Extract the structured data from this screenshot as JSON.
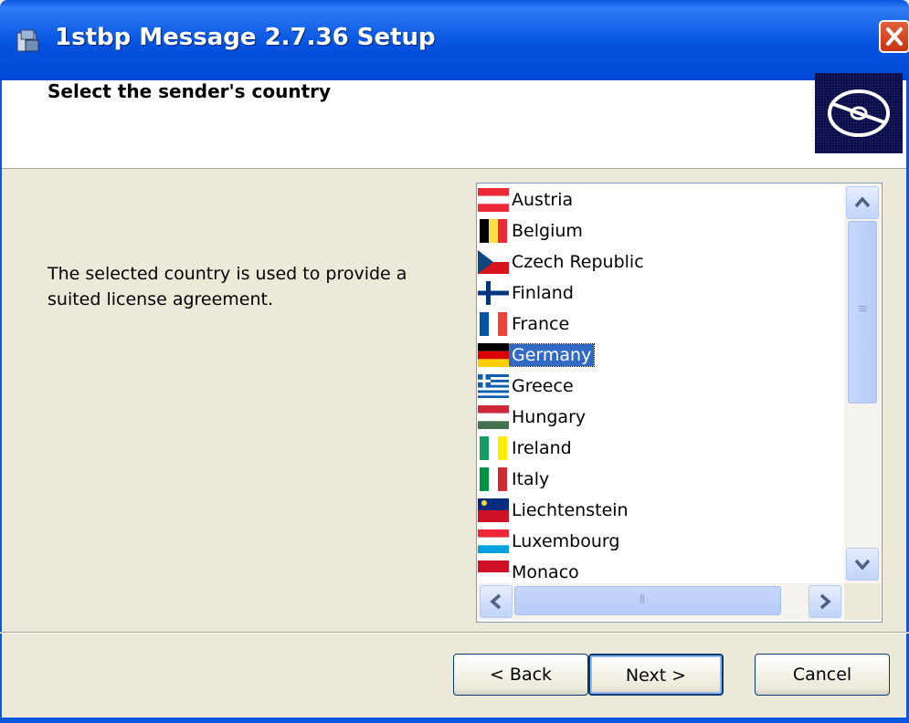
{
  "window": {
    "title": "1stbp Message 2.7.36 Setup",
    "close_glyph": "✕"
  },
  "header": {
    "title": "Select the sender's country"
  },
  "body": {
    "description": "The selected country is used to provide a suited license agreement."
  },
  "country_list": {
    "selected": "Germany",
    "items": [
      {
        "label": "Austria",
        "flag": "austria-flag-icon"
      },
      {
        "label": "Belgium",
        "flag": "belgium-flag-icon"
      },
      {
        "label": "Czech Republic",
        "flag": "czech-flag-icon"
      },
      {
        "label": "Finland",
        "flag": "finland-flag-icon"
      },
      {
        "label": "France",
        "flag": "france-flag-icon"
      },
      {
        "label": "Germany",
        "flag": "germany-flag-icon"
      },
      {
        "label": "Greece",
        "flag": "greece-flag-icon"
      },
      {
        "label": "Hungary",
        "flag": "hungary-flag-icon"
      },
      {
        "label": "Ireland",
        "flag": "ireland-flag-icon"
      },
      {
        "label": "Italy",
        "flag": "italy-flag-icon"
      },
      {
        "label": "Liechtenstein",
        "flag": "liechtenstein-flag-icon"
      },
      {
        "label": "Luxembourg",
        "flag": "luxembourg-flag-icon"
      },
      {
        "label": "Monaco",
        "flag": "monaco-flag-icon"
      }
    ]
  },
  "buttons": {
    "back": "< Back",
    "next": "Next >",
    "cancel": "Cancel"
  },
  "colors": {
    "titlebar": "#0653e0",
    "selection": "#316ac5",
    "dialog_bg": "#ece9d8"
  }
}
